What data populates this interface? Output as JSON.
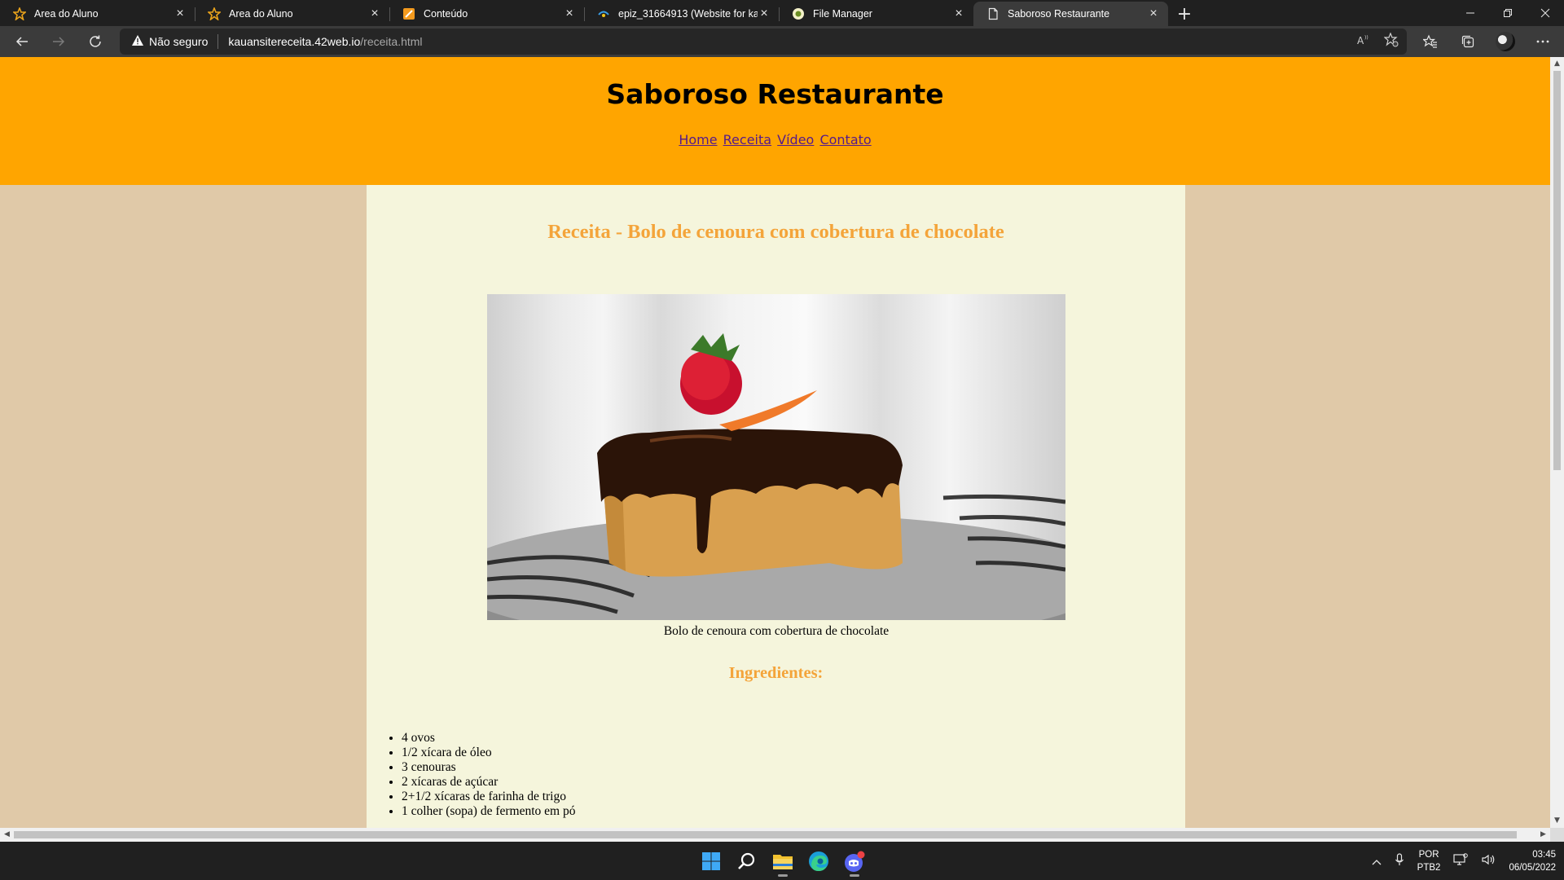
{
  "browser": {
    "tabs": [
      {
        "title": "Area do Aluno",
        "icon": "star-logo-icon",
        "active": false
      },
      {
        "title": "Area do Aluno",
        "icon": "star-logo-icon",
        "active": false
      },
      {
        "title": "Conteúdo",
        "icon": "pencil-logo-icon",
        "active": false
      },
      {
        "title": "epiz_31664913 (Website for kaua",
        "icon": "hosting-logo-icon",
        "active": false
      },
      {
        "title": "File Manager",
        "icon": "file-manager-icon",
        "active": false
      },
      {
        "title": "Saboroso Restaurante",
        "icon": "document-icon",
        "active": true
      }
    ],
    "address": {
      "security_label": "Não seguro",
      "host": "kauansitereceita.42web.io",
      "path": "/receita.html"
    }
  },
  "site": {
    "title": "Saboroso Restaurante",
    "nav": [
      "Home",
      "Receita",
      "Vídeo",
      "Contato"
    ],
    "recipe_title": "Receita - Bolo de cenoura com cobertura de chocolate",
    "image_caption": "Bolo de cenoura com cobertura de chocolate",
    "ingredients_title": "Ingredientes:",
    "ingredients": [
      "4 ovos",
      "1/2 xícara de óleo",
      "3 cenouras",
      "2 xícaras de açúcar",
      "2+1/2 xícaras de farinha de trigo",
      "1 colher (sopa) de fermento em pó"
    ],
    "colors": {
      "header_bg": "#ffa500",
      "page_bg": "#e0c9a8",
      "content_bg": "#f5f5dc",
      "heading": "#f4a43a"
    }
  },
  "taskbar": {
    "language": "POR",
    "keyboard": "PTB2",
    "time": "03:45",
    "date": "06/05/2022"
  }
}
